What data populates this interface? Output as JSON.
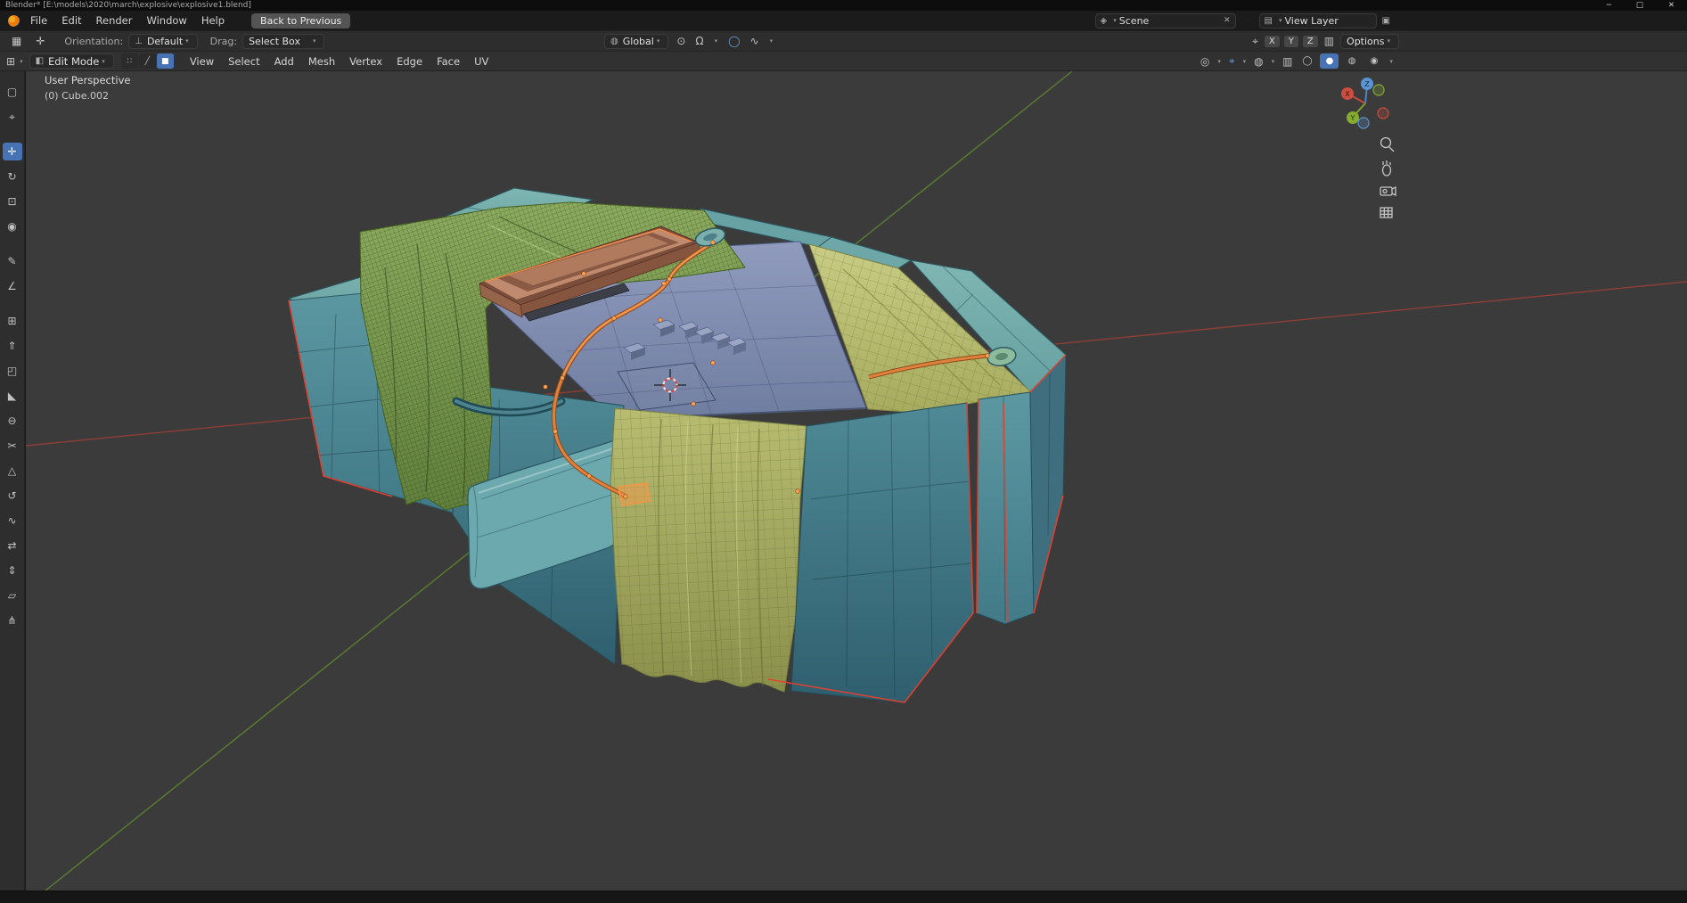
{
  "window": {
    "title": "Blender* [E:\\models\\2020\\march\\explosive\\explosive1.blend]",
    "minimize": "─",
    "maximize": "□",
    "close": "✕"
  },
  "icons": {
    "caret": "▾",
    "scene": "◈",
    "view_layer": "▤",
    "unlink": "✕",
    "copy": "▣",
    "editor": "⊞",
    "mode": "◧",
    "sel_vertex": "∷",
    "sel_edge": "╱",
    "sel_face": "■",
    "active_tool_a": "▦",
    "active_tool_b": "✛",
    "orientation": "⊥",
    "globe": "◍",
    "magnet": "Ω",
    "snap_target": "⊙",
    "prop_edit": "◯",
    "falloff": "∿",
    "pivot": "⌖",
    "mirror": "▥",
    "visibility": "◎",
    "gizmos": "⌖",
    "overlays": "◍",
    "xray": "▥",
    "shade_wireframe": "◯",
    "shade_solid": "●",
    "shade_material": "◍",
    "shade_rendered": "◉"
  },
  "menu_bar": {
    "items": [
      "File",
      "Edit",
      "Render",
      "Window",
      "Help"
    ],
    "back_button": "Back to Previous",
    "scene_label": "Scene",
    "view_layer_label": "View Layer"
  },
  "tool_settings": {
    "orientation_label": "Orientation:",
    "orientation_value": "Default",
    "drag_label": "Drag:",
    "drag_value": "Select Box",
    "transform_space": "Global",
    "axis_toggles": [
      "X",
      "Y",
      "Z"
    ],
    "options_label": "Options"
  },
  "viewport_header": {
    "mode": "Edit Mode",
    "menus": [
      "View",
      "Select",
      "Add",
      "Mesh",
      "Vertex",
      "Edge",
      "Face",
      "UV"
    ]
  },
  "left_toolbar": {
    "tools": [
      {
        "name": "select-box",
        "glyph": "▢"
      },
      {
        "name": "cursor",
        "glyph": "⌖"
      },
      {
        "name": "move",
        "glyph": "✛"
      },
      {
        "name": "rotate",
        "glyph": "↻"
      },
      {
        "name": "scale",
        "glyph": "⊡"
      },
      {
        "name": "transform",
        "glyph": "◉"
      },
      {
        "name": "annotate",
        "glyph": "✎"
      },
      {
        "name": "measure",
        "glyph": "∠"
      },
      {
        "name": "add-cube",
        "glyph": "⊞"
      },
      {
        "name": "extrude-region",
        "glyph": "⇑"
      },
      {
        "name": "inset-faces",
        "glyph": "◰"
      },
      {
        "name": "bevel",
        "glyph": "◣"
      },
      {
        "name": "loop-cut",
        "glyph": "⊖"
      },
      {
        "name": "knife",
        "glyph": "✂"
      },
      {
        "name": "poly-build",
        "glyph": "△"
      },
      {
        "name": "spin",
        "glyph": "↺"
      },
      {
        "name": "smooth",
        "glyph": "∿"
      },
      {
        "name": "edge-slide",
        "glyph": "⇄"
      },
      {
        "name": "shrink-fatten",
        "glyph": "⇕"
      },
      {
        "name": "shear",
        "glyph": "▱"
      },
      {
        "name": "rip-region",
        "glyph": "⋔"
      }
    ]
  },
  "viewport": {
    "perspective_label": "User Perspective",
    "object_label": "(0) Cube.002",
    "gizmo_axes": [
      "X",
      "Y",
      "Z"
    ]
  },
  "colors": {
    "accent_blue": "#4772b3",
    "block_teal": "#5f9aa2",
    "band_yellow": "#b5ba6e",
    "mesh_green": "#85a455",
    "panel_blue": "#8b97ba",
    "device_brown": "#bd8a6f",
    "wire_orange": "#e0823c",
    "selected_edge_red": "#e8402e",
    "axis_x_red": "#9c3f35",
    "axis_y_green": "#5f8a2e"
  }
}
